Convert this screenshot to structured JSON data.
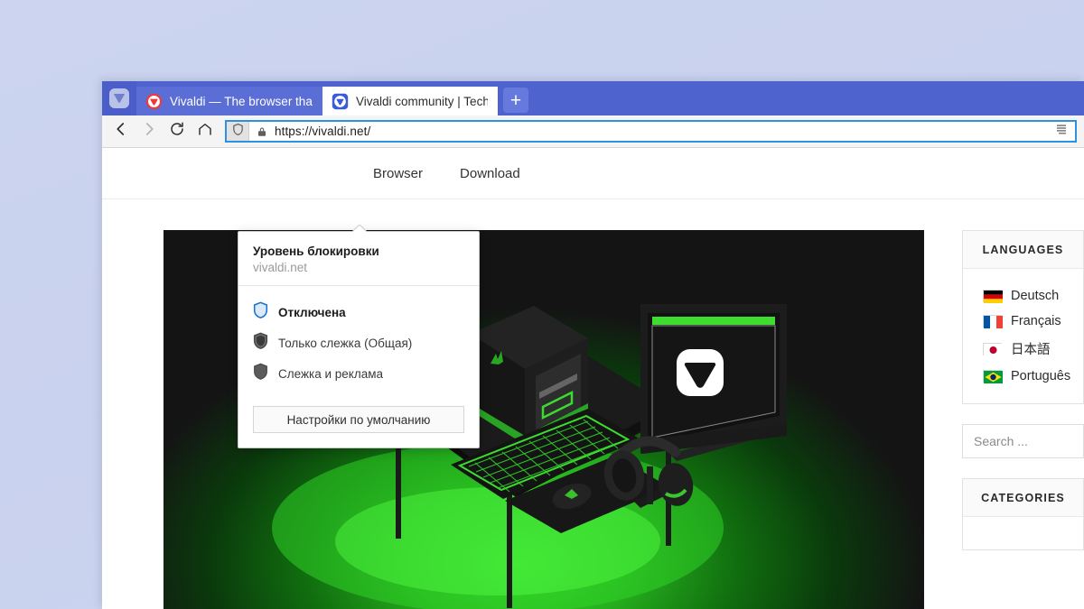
{
  "browser": {
    "vivaldi_menu_icon": "vivaldi-logo-icon",
    "tabs": [
      {
        "title": "Vivaldi — The browser that",
        "favicon": "vivaldi-red-icon",
        "active": true
      },
      {
        "title": "Vivaldi community | Tech fo",
        "favicon": "vivaldi-blue-icon",
        "active": false
      }
    ],
    "new_tab_label": "+",
    "toolbar": {
      "back_icon": "chevron-left-icon",
      "forward_icon": "chevron-right-icon",
      "reload_icon": "reload-icon",
      "home_icon": "home-icon",
      "shield_icon": "shield-icon",
      "lock_icon": "lock-icon",
      "page_actions_icon": "page-actions-icon"
    },
    "url": "https://vivaldi.net/"
  },
  "popup": {
    "title": "Уровень блокировки",
    "host": "vivaldi.net",
    "options": [
      {
        "label": "Отключена",
        "icon": "shield-outline-blue-icon",
        "selected": true
      },
      {
        "label": "Только слежка (Общая)",
        "icon": "shield-outline-gray-icon",
        "selected": false
      },
      {
        "label": "Слежка и реклама",
        "icon": "shield-filled-gray-icon",
        "selected": false
      }
    ],
    "default_button": "Настройки по умолчанию"
  },
  "site": {
    "nav": [
      {
        "label": "Browser"
      },
      {
        "label": "Download"
      }
    ],
    "hero_alt": "green-gaming-desk-illustration",
    "sidebar": {
      "languages_heading": "LANGUAGES",
      "languages": [
        {
          "name": "Deutsch",
          "flag": "flag-germany-icon"
        },
        {
          "name": "Français",
          "flag": "flag-france-icon"
        },
        {
          "name": "日本語",
          "flag": "flag-japan-icon"
        },
        {
          "name": "Português",
          "flag": "flag-brazil-icon"
        }
      ],
      "search_placeholder": "Search ...",
      "categories_heading": "CATEGORIES"
    }
  },
  "colors": {
    "tab_bar": "#4f63cf",
    "active_tab": "#5a6ed6",
    "url_focus": "#2f8fe0",
    "hero_green": "#3ddc2e",
    "desktop_bg": "#ccd4ef"
  }
}
